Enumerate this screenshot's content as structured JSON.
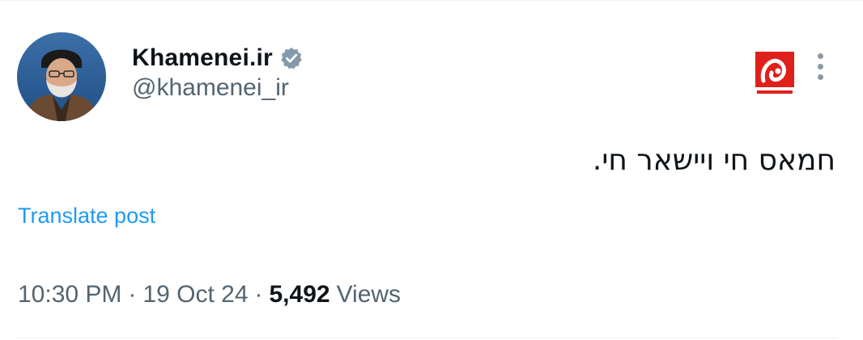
{
  "author": {
    "display_name": "Khamenei.ir",
    "handle": "@khamenei_ir",
    "verified": true
  },
  "post": {
    "text": "חמאס חי ויישאר חי.",
    "translate_label": "Translate post"
  },
  "meta": {
    "time": "10:30 PM",
    "separator": "·",
    "date": "19 Oct 24",
    "views_count": "5,492",
    "views_label": "Views"
  },
  "colors": {
    "link": "#1d9bf0",
    "secondary_text": "#536471",
    "primary_text": "#0f1419",
    "badge": "#829aab",
    "logo_red": "#e0201b"
  },
  "icons": {
    "verified": "verified-badge-icon",
    "more": "more-options-icon",
    "logo": "khamenei-site-logo"
  }
}
